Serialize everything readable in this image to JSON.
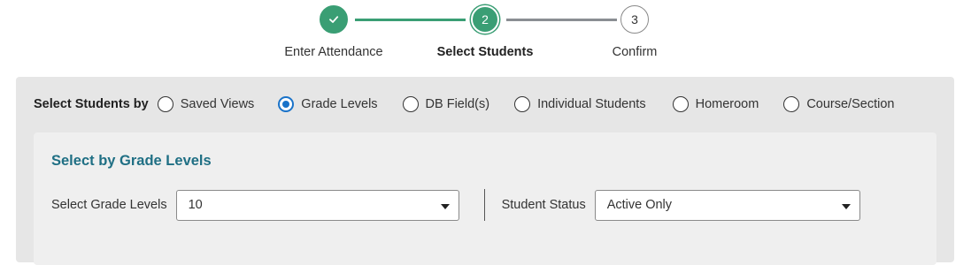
{
  "stepper": {
    "steps": [
      {
        "number": "",
        "label": "Enter Attendance",
        "state": "completed",
        "icon": "check-icon"
      },
      {
        "number": "2",
        "label": "Select Students",
        "state": "current"
      },
      {
        "number": "3",
        "label": "Confirm",
        "state": "upcoming"
      }
    ]
  },
  "selector": {
    "title": "Select Students by",
    "options": [
      {
        "label": "Saved Views",
        "checked": false
      },
      {
        "label": "Grade Levels",
        "checked": true
      },
      {
        "label": "DB Field(s)",
        "checked": false
      },
      {
        "label": "Individual Students",
        "checked": false
      },
      {
        "label": "Homeroom",
        "checked": false
      },
      {
        "label": "Course/Section",
        "checked": false
      }
    ]
  },
  "grade_panel": {
    "title": "Select by Grade Levels",
    "grade_label": "Select Grade Levels",
    "grade_value": "10",
    "status_label": "Student Status",
    "status_value": "Active Only"
  },
  "colors": {
    "accent_green": "#3a9e74",
    "radio_blue": "#1a73c9",
    "heading_teal": "#1f6f84"
  }
}
